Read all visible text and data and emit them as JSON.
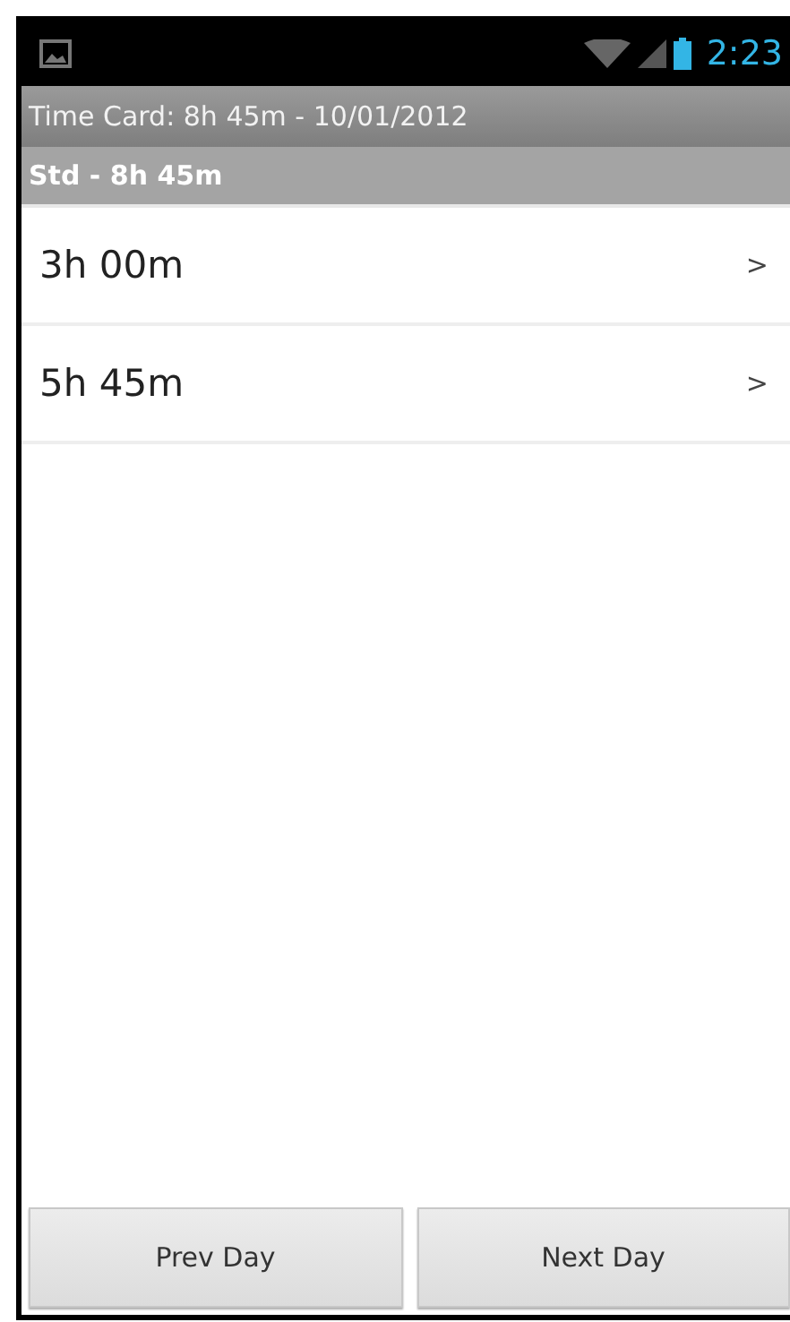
{
  "status_bar": {
    "time": "2:23"
  },
  "title_bar": {
    "title": "Time Card: 8h 45m - 10/01/2012"
  },
  "section": {
    "header": "Std - 8h 45m",
    "entries": [
      {
        "duration": "3h 00m",
        "chevron": ">"
      },
      {
        "duration": "5h 45m",
        "chevron": ">"
      }
    ]
  },
  "buttons": [
    "Prev Day",
    "Next Day"
  ]
}
